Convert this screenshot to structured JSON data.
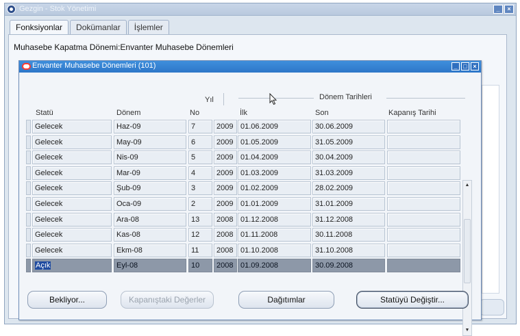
{
  "outer_window": {
    "title": "Gezgin - Stok Yönetimi",
    "tabs": [
      "Fonksiyonlar",
      "Dokümanlar",
      "İşlemler"
    ],
    "breadcrumb": "Muhasebe Kapatma Dönemi:Envanter Muhasebe Dönemleri"
  },
  "inner_window": {
    "title": "Envanter Muhasebe Dönemleri (101)"
  },
  "columns": {
    "yil_group": "Yıl",
    "donem_tarihleri_group": "Dönem Tarihleri",
    "statu": "Statü",
    "donem": "Dönem",
    "no": "No",
    "ilk": "İlk",
    "son": "Son",
    "kapanis": "Kapanış Tarihi"
  },
  "rows": [
    {
      "statu": "Gelecek",
      "donem": "Haz-09",
      "no": "7",
      "yil": "2009",
      "ilk": "01.06.2009",
      "son": "30.06.2009",
      "kapanis": ""
    },
    {
      "statu": "Gelecek",
      "donem": "May-09",
      "no": "6",
      "yil": "2009",
      "ilk": "01.05.2009",
      "son": "31.05.2009",
      "kapanis": ""
    },
    {
      "statu": "Gelecek",
      "donem": "Nis-09",
      "no": "5",
      "yil": "2009",
      "ilk": "01.04.2009",
      "son": "30.04.2009",
      "kapanis": ""
    },
    {
      "statu": "Gelecek",
      "donem": "Mar-09",
      "no": "4",
      "yil": "2009",
      "ilk": "01.03.2009",
      "son": "31.03.2009",
      "kapanis": ""
    },
    {
      "statu": "Gelecek",
      "donem": "Şub-09",
      "no": "3",
      "yil": "2009",
      "ilk": "01.02.2009",
      "son": "28.02.2009",
      "kapanis": ""
    },
    {
      "statu": "Gelecek",
      "donem": "Oca-09",
      "no": "2",
      "yil": "2009",
      "ilk": "01.01.2009",
      "son": "31.01.2009",
      "kapanis": ""
    },
    {
      "statu": "Gelecek",
      "donem": "Ara-08",
      "no": "13",
      "yil": "2008",
      "ilk": "01.12.2008",
      "son": "31.12.2008",
      "kapanis": ""
    },
    {
      "statu": "Gelecek",
      "donem": "Kas-08",
      "no": "12",
      "yil": "2008",
      "ilk": "01.11.2008",
      "son": "30.11.2008",
      "kapanis": ""
    },
    {
      "statu": "Gelecek",
      "donem": "Ekm-08",
      "no": "11",
      "yil": "2008",
      "ilk": "01.10.2008",
      "son": "31.10.2008",
      "kapanis": ""
    },
    {
      "statu": "Açık",
      "donem": "Eyl-08",
      "no": "10",
      "yil": "2008",
      "ilk": "01.09.2008",
      "son": "30.09.2008",
      "kapanis": "",
      "selected": true
    }
  ],
  "buttons": {
    "bekliyor": "Bekliyor...",
    "kapanistaki": "Kapanıştaki Değerler",
    "dagitimlar": "Dağıtımlar",
    "statuyu_degistir": "Statüyü Değiştir..."
  },
  "icons": {
    "app": "oracle-app-icon",
    "window_controls": [
      "minimize-icon",
      "close-icon"
    ],
    "inner_window_controls": [
      "minimize-icon",
      "maximize-icon",
      "close-icon"
    ]
  },
  "colors": {
    "inner_title_bar": "#2d76c8",
    "selected_row": "#8d98a8",
    "selection_highlight": "#1f4ba0"
  }
}
